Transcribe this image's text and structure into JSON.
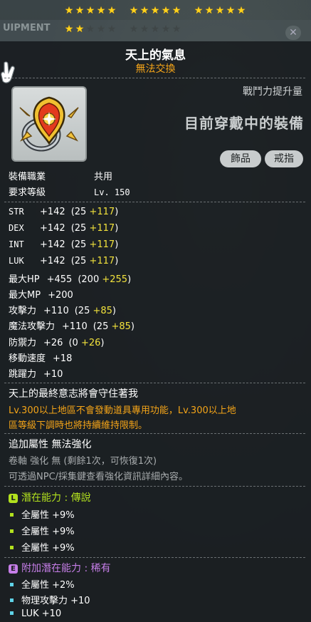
{
  "stars": {
    "filled": 17,
    "total": 25
  },
  "background": {
    "tab_label": "UIPMENT",
    "close_icon": "close-icon"
  },
  "item": {
    "name": "天上的氣息",
    "trade_status": "無法交換",
    "icon": "ring-item-icon"
  },
  "combat_power_label": "戰鬥力提升量",
  "equipped_label": "目前穿戴中的裝備",
  "categories": [
    "飾品",
    "戒指"
  ],
  "job": {
    "label": "裝備職業",
    "value": "共用"
  },
  "req_level": {
    "label": "要求等級",
    "value": "Lv. 150"
  },
  "stats": [
    {
      "name": "STR",
      "total": "+142",
      "base": "(25 ",
      "bonus": "+117",
      "close": ")"
    },
    {
      "name": "DEX",
      "total": "+142",
      "base": "(25 ",
      "bonus": "+117",
      "close": ")"
    },
    {
      "name": "INT",
      "total": "+142",
      "base": "(25 ",
      "bonus": "+117",
      "close": ")"
    },
    {
      "name": "LUK",
      "total": "+142",
      "base": "(25 ",
      "bonus": "+117",
      "close": ")"
    },
    {
      "name": "最大HP",
      "total": "+455",
      "base": "(200 ",
      "bonus": "+255",
      "close": ")"
    },
    {
      "name": "最大MP",
      "total": "+200",
      "base": "",
      "bonus": "",
      "close": ""
    },
    {
      "name": "攻擊力",
      "total": "+110",
      "base": "(25 ",
      "bonus": "+85",
      "close": ")"
    },
    {
      "name": "魔法攻擊力",
      "total": "+110",
      "base": "(25 ",
      "bonus": "+85",
      "close": ")"
    },
    {
      "name": "防禦力",
      "total": "+26",
      "base": "(0 ",
      "bonus": "+26",
      "close": ")"
    },
    {
      "name": "移動速度",
      "total": "+18",
      "base": "",
      "bonus": "",
      "close": ""
    },
    {
      "name": "跳躍力",
      "total": "+10",
      "base": "",
      "bonus": "",
      "close": ""
    }
  ],
  "description": {
    "line1": "天上的最終意志將會守住著我",
    "line2": "Lv.300以上地區不會發動道具專用功能，Lv.300以上地",
    "line3": "區等級下調時也將持續維持限制。"
  },
  "enhance": {
    "title": "追加屬性 無法強化",
    "scroll": "卷軸 強化 無 (剩餘1次，可恢復1次)",
    "npc": "可透過NPC/採集鍵查看強化資訊詳細內容。"
  },
  "potential": {
    "badge": "L",
    "title": "潛在能力 : 傳說",
    "lines": [
      "全屬性 +9%",
      "全屬性 +9%",
      "全屬性 +9%"
    ]
  },
  "additional_potential": {
    "badge": "E",
    "title": "附加潛在能力 : 稀有",
    "lines": [
      "全屬性 +2%",
      "物理攻擊力 +10",
      "LUK +10"
    ]
  },
  "colors": {
    "bonus": "#f2e23c",
    "untradeable": "#f4a418",
    "legendary": "#b2e11e",
    "epic": "#c67ee8",
    "star_on": "#ffd21c"
  }
}
